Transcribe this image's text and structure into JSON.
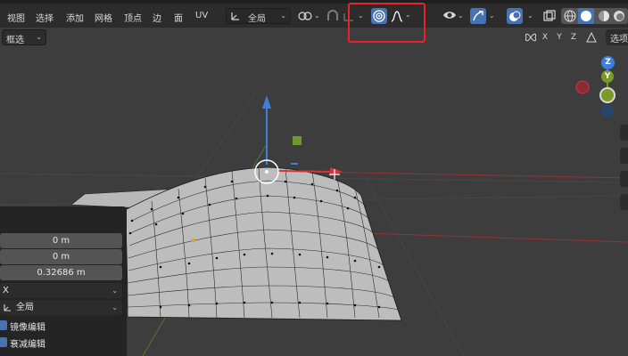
{
  "menu": {
    "view": "视图",
    "select": "选择",
    "add": "添加",
    "mesh": "网格",
    "vertex": "顶点",
    "edge": "边",
    "face": "面",
    "uv": "UV"
  },
  "toolbar": {
    "transform_orientation": "全局",
    "proportional_icon": "proportional-edit-icon",
    "falloff_icon": "smooth-falloff-icon",
    "select_mode": "框选",
    "axes": [
      "X",
      "Y",
      "Z"
    ],
    "options": "选项"
  },
  "gizmo": {
    "z_label": "Z",
    "y_label": "Y"
  },
  "operator_panel": {
    "move_x": "0 m",
    "move_y": "0 m",
    "move_z": "0.32686 m",
    "constraint_axis": "X",
    "orientation": "全局",
    "mirror_editing": "镜像编辑",
    "proportional_editing": "衰减编辑"
  },
  "colors": {
    "highlight": "#e8242a",
    "accent": "#4772b3",
    "x_axis": "#d4343f",
    "y_axis": "#7a9a2a",
    "z_axis": "#3d7fd9"
  }
}
